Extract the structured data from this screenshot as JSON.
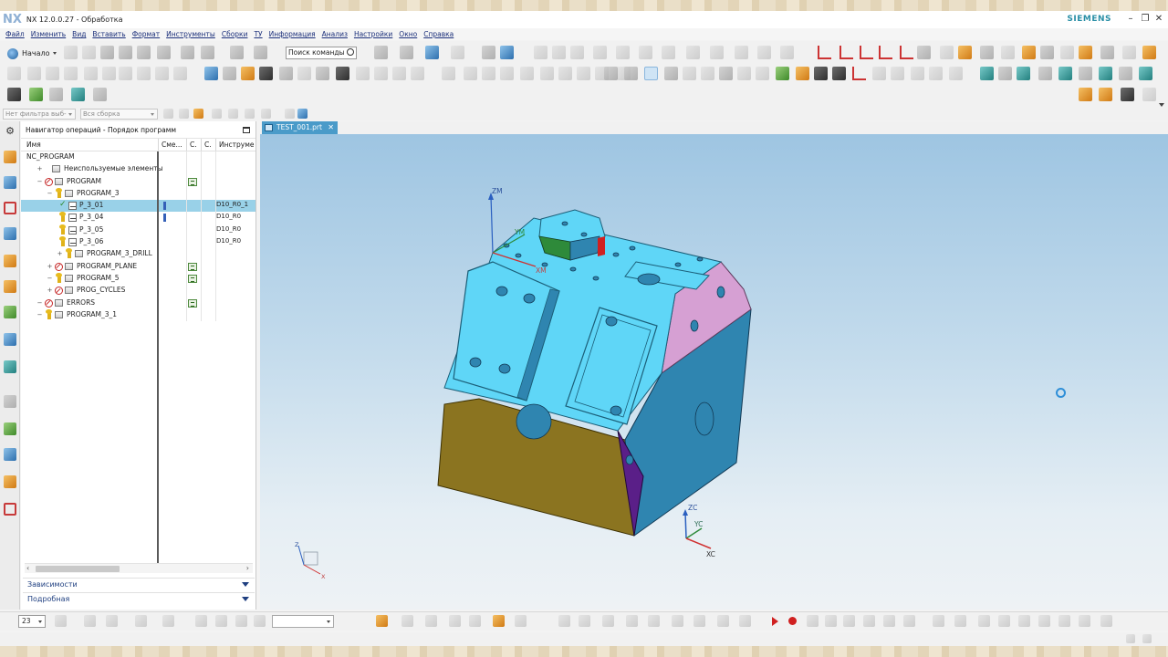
{
  "titlebar": {
    "logo": "NX",
    "title": "NX 12.0.0.27 - Обработка",
    "brand": "SIEMENS",
    "minimize": "–",
    "restore": "❐",
    "close": "✕"
  },
  "menu": [
    "Файл",
    "Изменить",
    "Вид",
    "Вставить",
    "Формат",
    "Инструменты",
    "Сборки",
    "ТУ",
    "Информация",
    "Анализ",
    "Настройки",
    "Окно",
    "Справка"
  ],
  "toolbar": {
    "start_label": "Начало",
    "search_placeholder": "Поиск команды"
  },
  "filters": {
    "type_filter": "Нет фильтра выб-",
    "assembly_filter": "Вся сборка"
  },
  "navigator": {
    "title": "Навигатор операций - Порядок программ",
    "columns": [
      "Имя",
      "Сме...",
      "С.",
      "С.",
      "Инструме"
    ],
    "rows": [
      {
        "name": "NC_PROGRAM",
        "indent": 0,
        "kind": "root",
        "tool": ""
      },
      {
        "name": "Неиспользуемые элементы",
        "indent": 1,
        "kind": "folder",
        "tool": ""
      },
      {
        "name": "PROGRAM",
        "indent": 1,
        "kind": "blocked",
        "tool": ""
      },
      {
        "name": "PROGRAM_3",
        "indent": 2,
        "kind": "key",
        "tool": ""
      },
      {
        "name": "P_3_01",
        "indent": 3,
        "kind": "op-check",
        "tool": "D10_R0_1",
        "selected": true
      },
      {
        "name": "P_3_04",
        "indent": 3,
        "kind": "op",
        "tool": "D10_R0"
      },
      {
        "name": "P_3_05",
        "indent": 3,
        "kind": "op",
        "tool": "D10_R0"
      },
      {
        "name": "P_3_06",
        "indent": 3,
        "kind": "op",
        "tool": "D10_R0"
      },
      {
        "name": "PROGRAM_3_DRILL",
        "indent": 3,
        "kind": "key-folder",
        "tool": ""
      },
      {
        "name": "PROGRAM_PLANE",
        "indent": 2,
        "kind": "blocked",
        "tool": ""
      },
      {
        "name": "PROGRAM_5",
        "indent": 2,
        "kind": "key",
        "tool": ""
      },
      {
        "name": "PROG_CYCLES",
        "indent": 2,
        "kind": "blocked",
        "tool": ""
      },
      {
        "name": "ERRORS",
        "indent": 1,
        "kind": "blocked",
        "tool": ""
      },
      {
        "name": "PROGRAM_3_1",
        "indent": 1,
        "kind": "key",
        "tool": ""
      }
    ],
    "panels": [
      "Зависимости",
      "Подробная"
    ]
  },
  "document_tab": "TEST_001.prt",
  "viewport": {
    "csys_model": {
      "z": "ZM",
      "y": "YM",
      "x": "XM"
    },
    "csys_work": {
      "z": "ZC",
      "y": "YC",
      "x": "XC"
    },
    "triad_small": {
      "z": "Z",
      "x": "X"
    }
  },
  "bottombar": {
    "zoom_value": "23"
  },
  "colors": {
    "accent_blue": "#4a9bc9",
    "part_cyan": "#5fd6f7",
    "part_steel": "#2f85b0",
    "part_olive": "#8b7420",
    "part_pink": "#d6a0d3",
    "part_purple": "#5a1f88",
    "selection": "#99d1e8"
  }
}
